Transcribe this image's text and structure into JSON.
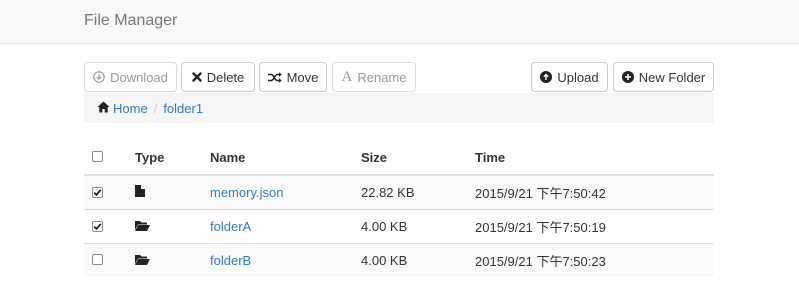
{
  "header": {
    "title": "File Manager"
  },
  "toolbar": {
    "download_label": "Download",
    "delete_label": "Delete",
    "move_label": "Move",
    "rename_label": "Rename",
    "upload_label": "Upload",
    "new_folder_label": "New Folder"
  },
  "breadcrumb": {
    "home_label": "Home",
    "current": "folder1"
  },
  "table": {
    "columns": {
      "type": "Type",
      "name": "Name",
      "size": "Size",
      "time": "Time"
    },
    "rows": [
      {
        "checked": true,
        "type_icon": "file-icon",
        "name": "memory.json",
        "size": "22.82 KB",
        "time": "2015/9/21 下午7:50:42"
      },
      {
        "checked": true,
        "type_icon": "folder-open-icon",
        "name": "folderA",
        "size": "4.00 KB",
        "time": "2015/9/21 下午7:50:19"
      },
      {
        "checked": false,
        "type_icon": "folder-open-icon",
        "name": "folderB",
        "size": "4.00 KB",
        "time": "2015/9/21 下午7:50:23"
      }
    ]
  },
  "colors": {
    "link": "#337ab7",
    "navbar_bg": "#f8f8f8",
    "breadcrumb_bg": "#f5f5f5",
    "stripe": "#f9f9f9"
  }
}
